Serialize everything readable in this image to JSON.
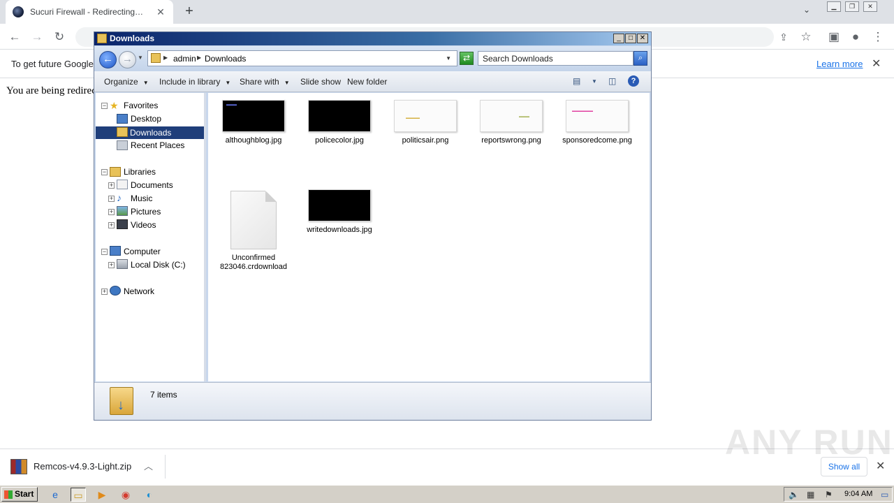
{
  "browser": {
    "tab_title": "Sucuri Firewall - Redirecting…",
    "tab_close": "✕",
    "new_tab": "+",
    "tab_search": "⌄"
  },
  "infobar": {
    "text": "To get future Google",
    "link": "Learn more",
    "close": "✕"
  },
  "page": {
    "text": "You are being redirec"
  },
  "explorer": {
    "title": "Downloads",
    "breadcrumb": [
      "admin",
      "Downloads"
    ],
    "search_placeholder": "Search Downloads",
    "commands": {
      "organize": "Organize",
      "include_in_library": "Include in library",
      "share_with": "Share with",
      "slide_show": "Slide show",
      "new_folder": "New folder"
    },
    "nav": {
      "favorites": "Favorites",
      "desktop": "Desktop",
      "downloads": "Downloads",
      "recent_places": "Recent Places",
      "libraries": "Libraries",
      "documents": "Documents",
      "music": "Music",
      "pictures": "Pictures",
      "videos": "Videos",
      "computer": "Computer",
      "local_disk": "Local Disk (C:)",
      "network": "Network"
    },
    "files": [
      {
        "name": "althoughblog.jpg",
        "thumb": "dark"
      },
      {
        "name": "policecolor.jpg",
        "thumb": "dark"
      },
      {
        "name": "politicsair.png",
        "thumb": "light"
      },
      {
        "name": "reportswrong.png",
        "thumb": "light"
      },
      {
        "name": "sponsoredcome.png",
        "thumb": "light"
      },
      {
        "name": "Unconfirmed 823046.crdownload",
        "thumb": "doc"
      },
      {
        "name": "writedownloads.jpg",
        "thumb": "dark"
      }
    ],
    "status": "7 items"
  },
  "download_shelf": {
    "file": "Remcos-v4.9.3-Light.zip",
    "show_all": "Show all",
    "close": "✕"
  },
  "watermark": "ANY RUN",
  "taskbar": {
    "start": "Start",
    "clock": "9:04 AM"
  }
}
